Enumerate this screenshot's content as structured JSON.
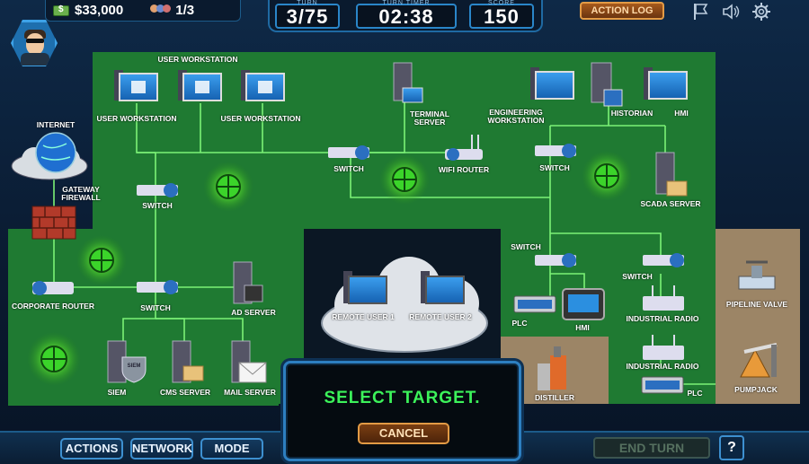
{
  "hud": {
    "money": "$33,000",
    "users": "1/3",
    "turn_caption": "TURN",
    "turn": "3/75",
    "timer_caption": "TURN TIMER",
    "timer": "02:38",
    "score_caption": "SCORE",
    "score": "150",
    "action_log": "ACTION LOG"
  },
  "icons": {
    "money": "money-icon",
    "users": "users-icon",
    "flag": "flag-icon",
    "sound": "speaker-icon",
    "settings": "gear-icon",
    "target": "target-icon"
  },
  "colors": {
    "zone_green": "#1f7a32",
    "zone_tan": "#9c8566",
    "wire": "#7cf276",
    "select_text": "#3cf25a",
    "accent_blue": "#2d7fc0",
    "cancel_orange": "#e39b45"
  },
  "nodes": {
    "internet": "INTERNET",
    "gateway_firewall": "GATEWAY FIREWALL",
    "corporate_router": "CORPORATE ROUTER",
    "switch": "SWITCH",
    "user_workstation": "USER WORKSTATION",
    "terminal_server": "TERMINAL SERVER",
    "wifi_router": "WIFI ROUTER",
    "engineering_workstation": "ENGINEERING WORKSTATION",
    "historian": "HISTORIAN",
    "hmi": "HMI",
    "scada_server": "SCADA SERVER",
    "ad_server": "AD SERVER",
    "siem": "SIEM",
    "cms_server": "CMS SERVER",
    "mail_server": "MAIL SERVER",
    "remote_user_1": "REMOTE USER 1",
    "remote_user_2": "REMOTE USER 2",
    "plc": "PLC",
    "industrial_radio": "INDUSTRIAL RADIO",
    "distiller": "DISTILLER",
    "pipeline_valve": "PIPELINE VALVE",
    "pumpjack": "PUMPJACK",
    "siem_badge": "SIEM"
  },
  "overlay": {
    "title": "SELECT TARGET.",
    "cancel": "CANCEL"
  },
  "bottom": {
    "actions": "ACTIONS",
    "network": "NETWORK",
    "mode": "MODE",
    "end_turn": "END TURN",
    "help": "?"
  }
}
